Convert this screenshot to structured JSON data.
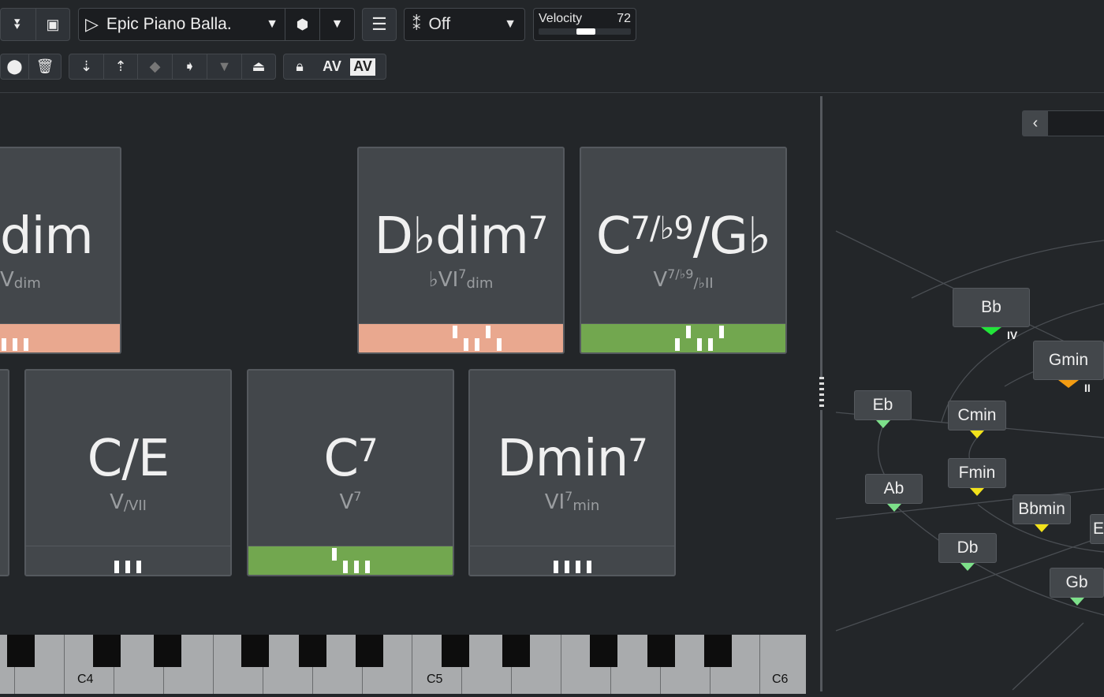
{
  "toolbar": {
    "preset_name": "Epic Piano Balla.",
    "voicing_value": "Off",
    "velocity_label": "Velocity",
    "velocity_value": "72",
    "velocity_fraction": 0.5,
    "av_label": "AV",
    "av_boxed_label": "AV"
  },
  "pads": [
    {
      "name": "dim",
      "sup": "",
      "func": "V",
      "func_sub": "dim",
      "func_sup": "",
      "color": "#e9a88f",
      "notes": [
        0,
        0,
        0
      ]
    },
    {
      "name": "D♭dim",
      "sup": "7",
      "func": "♭VI",
      "func_sub": "dim",
      "func_sup": "7",
      "color": "#e9a88f",
      "notes": [
        1,
        0,
        0,
        1,
        0
      ]
    },
    {
      "name": "C",
      "sup": "7/♭9",
      "name2": "/G♭",
      "func": "V",
      "func_sup": "7/♭9",
      "func_sub": "/♭II",
      "color": "#72a74f",
      "notes": [
        0,
        1,
        0,
        0,
        1
      ]
    },
    {
      "name": "C/E",
      "sup": "",
      "func": "V",
      "func_sub": "/VII",
      "func_sup": "",
      "color": "",
      "notes": [
        0,
        0,
        0
      ]
    },
    {
      "name": "C",
      "sup": "7",
      "func": "V",
      "func_sub": "",
      "func_sup": "7",
      "color": "#72a74f",
      "notes": [
        1,
        0,
        0,
        0
      ]
    },
    {
      "name": "Dmin",
      "sup": "7",
      "func": "VI",
      "func_sub": "min",
      "func_sup": "7",
      "color": "",
      "notes": [
        0,
        0,
        0,
        0
      ]
    }
  ],
  "keyboard": {
    "labels": [
      "C4",
      "C5",
      "C6"
    ]
  },
  "chord_map": {
    "nodes": [
      {
        "label": "Bb",
        "marker": "#22e53a",
        "roman": "IV"
      },
      {
        "label": "Gmin",
        "marker": "#f39c12",
        "roman": "II"
      },
      {
        "label": "Eb",
        "marker": "#7de08a",
        "roman": ""
      },
      {
        "label": "Cmin",
        "marker": "#f2e21b",
        "roman": ""
      },
      {
        "label": "Fmin",
        "marker": "#f2e21b",
        "roman": ""
      },
      {
        "label": "Ab",
        "marker": "#7de08a",
        "roman": ""
      },
      {
        "label": "Bbmin",
        "marker": "#f2e21b",
        "roman": ""
      },
      {
        "label": "Db",
        "marker": "#7de08a",
        "roman": ""
      },
      {
        "label": "E",
        "marker": "",
        "roman": ""
      },
      {
        "label": "Gb",
        "marker": "#7de08a",
        "roman": ""
      }
    ]
  }
}
